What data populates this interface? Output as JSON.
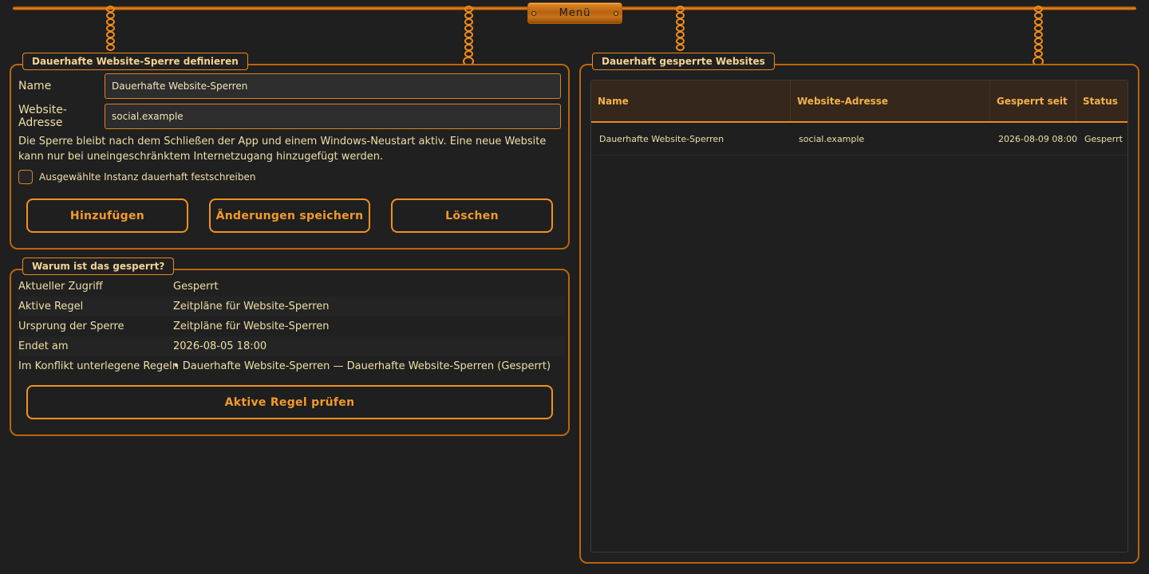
{
  "menu": {
    "label": "Menü"
  },
  "define_panel": {
    "title": "Dauerhafte Website-Sperre definieren",
    "name_label": "Name",
    "name_value": "Dauerhafte Website-Sperren",
    "address_label": "Website-Adresse",
    "address_value": "social.example",
    "info": "Die Sperre bleibt nach dem Schließen der App und einem Windows-Neustart aktiv. Eine neue Website kann nur bei uneingeschränktem Internetzugang hinzugefügt werden.",
    "checkbox_label": "Ausgewählte Instanz dauerhaft festschreiben",
    "checkbox_checked": false,
    "add_button": "Hinzufügen",
    "save_button": "Änderungen speichern",
    "delete_button": "Löschen"
  },
  "why_panel": {
    "title": "Warum ist das gesperrt?",
    "rows": [
      {
        "key": "Aktueller Zugriff",
        "value": "Gesperrt"
      },
      {
        "key": "Aktive Regel",
        "value": "Zeitpläne für Website-Sperren"
      },
      {
        "key": "Ursprung der Sperre",
        "value": "Zeitpläne für Website-Sperren"
      },
      {
        "key": "Endet am",
        "value": "2026-08-05 18:00"
      },
      {
        "key": "Im Konflikt unterlegene Regeln",
        "value": "• Dauerhafte Website-Sperren — Dauerhafte Website-Sperren (Gesperrt)"
      }
    ],
    "check_button": "Aktive Regel prüfen"
  },
  "blocked_panel": {
    "title": "Dauerhaft gesperrte Websites",
    "columns": [
      "Name",
      "Website-Adresse",
      "Gesperrt seit",
      "Status"
    ],
    "rows": [
      [
        "Dauerhafte Website-Sperren",
        "social.example",
        "2026-08-09 08:00",
        "Gesperrt"
      ]
    ]
  },
  "colors": {
    "accent": "#f0921f",
    "background": "#1f1f1f",
    "text": "#f0dfa8",
    "header_bg": "#35271b"
  }
}
